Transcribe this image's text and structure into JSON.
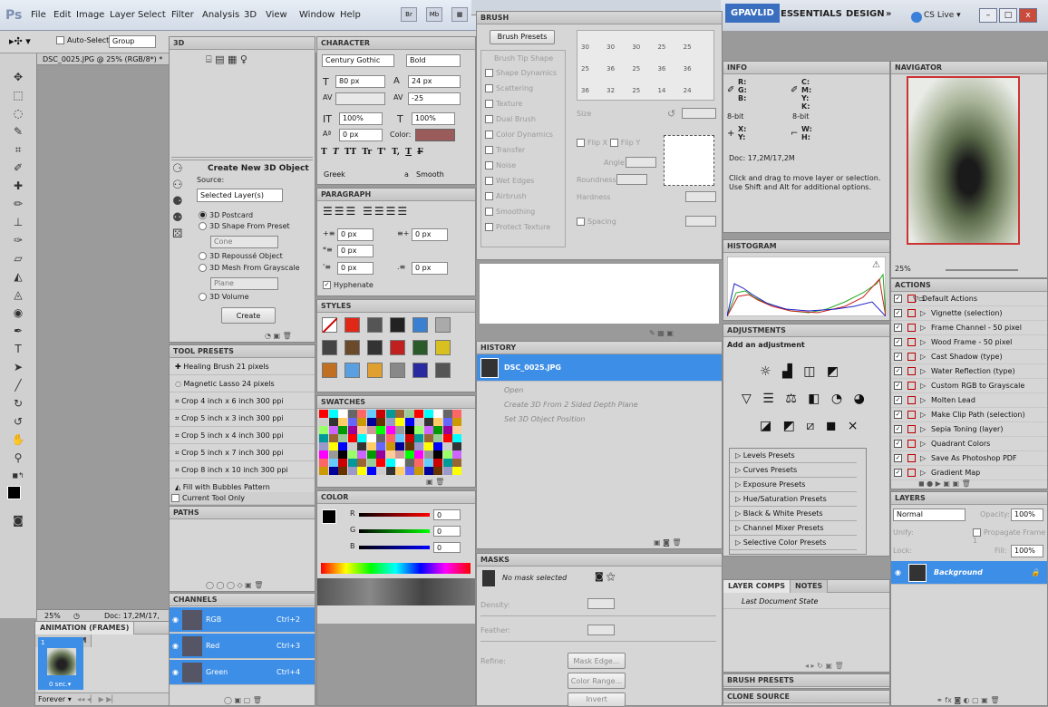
{
  "app": {
    "logo": "Ps",
    "menu": [
      "File",
      "Edit",
      "Image",
      "Layer",
      "Select",
      "Filter",
      "Analysis",
      "3D",
      "View",
      "Window",
      "Help"
    ],
    "launch": [
      "Br",
      "Mb"
    ]
  },
  "workspace": {
    "gpavlid": "GPAVLID",
    "essentials": "ESSENTIALS",
    "design": "DESIGN",
    "more": "»",
    "cslive": "CS Live ▾",
    "min": "–",
    "max": "□",
    "close": "x"
  },
  "options": {
    "auto_select": "Auto-Select:",
    "group": "Group"
  },
  "document": {
    "title": "DSC_0025.JPG @ 25% (RGB/8*) *",
    "zoom": "25%",
    "doc": "Doc: 17,2M/17,"
  },
  "animation": {
    "tabs": [
      "ANIMATION (FRAMES)",
      "MEASUREM"
    ],
    "frame_num": "1",
    "frame_time": "0 sec.▾",
    "loop": "Forever ▾"
  },
  "panel_3d": {
    "title": "3D",
    "heading": "Create New 3D Object",
    "source_label": "Source:",
    "source_value": "Selected Layer(s)",
    "options": [
      "3D Postcard",
      "3D Shape From Preset",
      "3D Repoussé Object",
      "3D Mesh From Grayscale",
      "3D Volume"
    ],
    "shape_value": "Cone",
    "mesh_value": "Plane",
    "create": "Create"
  },
  "tool_presets": {
    "title": "TOOL PRESETS",
    "items": [
      "Healing Brush 21 pixels",
      "Magnetic Lasso 24 pixels",
      "Crop 4 inch x 6 inch 300 ppi",
      "Crop 5 inch x 3 inch 300 ppi",
      "Crop 5 inch x 4 inch 300 ppi",
      "Crop 5 inch x 7 inch 300 ppi",
      "Crop 8 inch x 10 inch 300 ppi",
      "Fill with Bubbles Pattern"
    ],
    "current_only": "Current Tool Only"
  },
  "paths": {
    "title": "PATHS"
  },
  "channels": {
    "title": "CHANNELS",
    "items": [
      {
        "name": "RGB",
        "key": "Ctrl+2"
      },
      {
        "name": "Red",
        "key": "Ctrl+3"
      },
      {
        "name": "Green",
        "key": "Ctrl+4"
      }
    ]
  },
  "character": {
    "title": "CHARACTER",
    "font": "Century Gothic",
    "style": "Bold",
    "size": "80 px",
    "leading": "24 px",
    "tracking": "-25",
    "vscale": "100%",
    "hscale": "100%",
    "baseline": "0 px",
    "color_label": "Color:",
    "glyphs": [
      "T",
      "T",
      "TT",
      "Tr",
      "T'",
      "T,",
      "T",
      "F"
    ],
    "language": "Greek",
    "aa_label": "a",
    "aa": "Smooth"
  },
  "paragraph": {
    "title": "PARAGRAPH",
    "indent_left": "0 px",
    "indent_right": "0 px",
    "indent_first": "0 px",
    "space_before": "0 px",
    "space_after": "0 px",
    "hyphenate": "Hyphenate"
  },
  "styles": {
    "title": "STYLES"
  },
  "swatches": {
    "title": "SWATCHES"
  },
  "color": {
    "title": "COLOR",
    "r": "R",
    "g": "G",
    "b": "B",
    "rv": "0",
    "gv": "0",
    "bv": "0"
  },
  "brush": {
    "title": "BRUSH",
    "presets_btn": "Brush Presets",
    "options": [
      "Brush Tip Shape",
      "Shape Dynamics",
      "Scattering",
      "Texture",
      "Dual Brush",
      "Color Dynamics",
      "Transfer",
      "Noise",
      "Wet Edges",
      "Airbrush",
      "Smoothing",
      "Protect Texture"
    ],
    "sizes_row1": [
      "30",
      "30",
      "30",
      "25",
      "25"
    ],
    "sizes_row2": [
      "25",
      "36",
      "25",
      "36",
      "36"
    ],
    "sizes_row3": [
      "36",
      "32",
      "25",
      "14",
      "24"
    ],
    "size_label": "Size",
    "flip_x": "Flip X",
    "flip_y": "Flip Y",
    "angle": "Angle:",
    "roundness": "Roundness:",
    "hardness": "Hardness",
    "spacing": "Spacing"
  },
  "history": {
    "title": "HISTORY",
    "snapshot": "DSC_0025.JPG",
    "states": [
      "Open",
      "Create 3D From 2 Sided Depth Plane",
      "Set 3D Object Position"
    ]
  },
  "masks": {
    "title": "MASKS",
    "status": "No mask selected",
    "density": "Density:",
    "feather": "Feather:",
    "refine": "Refine:",
    "mask_edge": "Mask Edge...",
    "color_range": "Color Range...",
    "invert": "Invert"
  },
  "info": {
    "title": "INFO",
    "r": "R:",
    "g": "G:",
    "b": "B:",
    "c": "C:",
    "m": "M:",
    "y": "Y:",
    "k": "K:",
    "bit1": "8-bit",
    "bit2": "8-bit",
    "x": "X:",
    "yv": "Y:",
    "w": "W:",
    "h": "H:",
    "doc": "Doc: 17,2M/17,2M",
    "hint": "Click and drag to move layer or selection.  Use Shift and Alt for additional options."
  },
  "histogram": {
    "title": "HISTOGRAM"
  },
  "adjustments": {
    "title": "ADJUSTMENTS",
    "heading": "Add an adjustment",
    "presets": [
      "Levels Presets",
      "Curves Presets",
      "Exposure Presets",
      "Hue/Saturation Presets",
      "Black & White Presets",
      "Channel Mixer Presets",
      "Selective Color Presets"
    ]
  },
  "layer_comps": {
    "tabs": [
      "LAYER COMPS",
      "NOTES"
    ],
    "last": "Last Document State"
  },
  "brush_presets": {
    "title": "BRUSH PRESETS"
  },
  "clone_source": {
    "title": "CLONE SOURCE"
  },
  "navigator": {
    "title": "NAVIGATOR",
    "zoom": "25%"
  },
  "actions": {
    "title": "ACTIONS",
    "set": "Default Actions",
    "items": [
      "Vignette (selection)",
      "Frame Channel - 50 pixel",
      "Wood Frame - 50 pixel",
      "Cast Shadow (type)",
      "Water Reflection (type)",
      "Custom RGB to Grayscale",
      "Molten Lead",
      "Make Clip Path (selection)",
      "Sepia Toning (layer)",
      "Quadrant Colors",
      "Save As Photoshop PDF",
      "Gradient Map"
    ]
  },
  "layers": {
    "title": "LAYERS",
    "blend": "Normal",
    "opacity_label": "Opacity:",
    "opacity": "100%",
    "unify": "Unify:",
    "propagate": "Propagate Frame 1",
    "lock": "Lock:",
    "fill_label": "Fill:",
    "fill": "100%",
    "layer": "Background"
  }
}
